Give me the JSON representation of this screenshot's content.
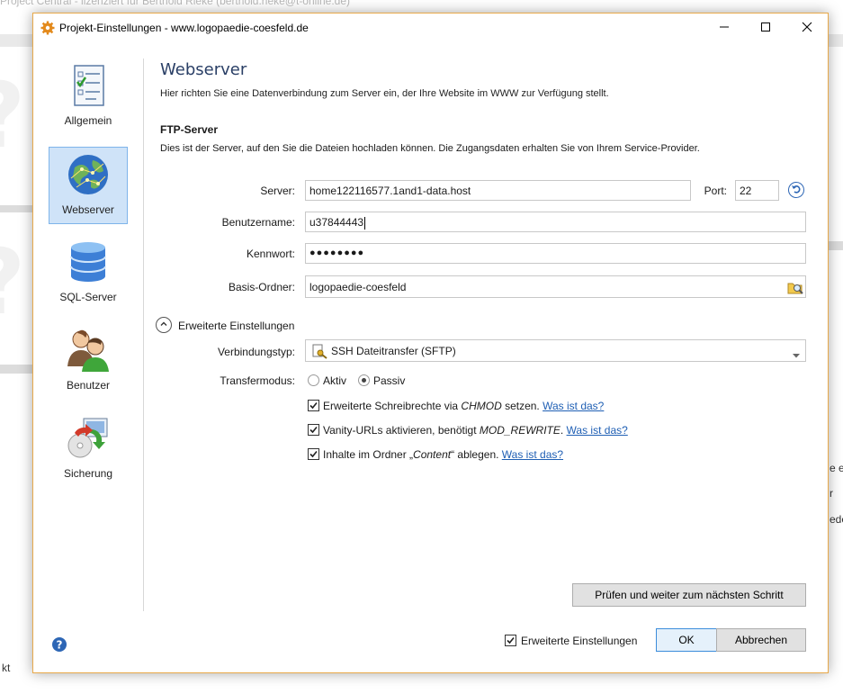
{
  "background": {
    "title": "Project Central - lizenziert für Berthold Rieke (berthold.rieke@t-online.de)",
    "right_snippets": [
      "e er",
      "r",
      "ede"
    ],
    "bottom_left_text": "kt"
  },
  "dialog": {
    "title": "Projekt-Einstellungen - www.logopaedie-coesfeld.de",
    "sidebar": {
      "items": [
        {
          "label": "Allgemein",
          "icon": "checklist-icon",
          "active": false
        },
        {
          "label": "Webserver",
          "icon": "globe-icon",
          "active": true
        },
        {
          "label": "SQL-Server",
          "icon": "database-icon",
          "active": false
        },
        {
          "label": "Benutzer",
          "icon": "users-icon",
          "active": false
        },
        {
          "label": "Sicherung",
          "icon": "backup-icon",
          "active": false
        }
      ]
    },
    "page": {
      "title": "Webserver",
      "description": "Hier richten Sie eine Datenverbindung zum Server ein, der Ihre Website im WWW zur Verfügung stellt.",
      "section_title": "FTP-Server",
      "section_description": "Dies ist der Server, auf den Sie die Dateien hochladen können. Die Zugangsdaten erhalten Sie von Ihrem Service-Provider."
    },
    "form": {
      "server_label": "Server:",
      "server_value": "home122116577.1and1-data.host",
      "port_label": "Port:",
      "port_value": "22",
      "username_label": "Benutzername:",
      "username_value": "u37844443",
      "password_label": "Kennwort:",
      "password_value": "●●●●●●●●",
      "base_folder_label": "Basis-Ordner:",
      "base_folder_value": "logopaedie-coesfeld"
    },
    "advanced": {
      "toggle_label": "Erweiterte Einstellungen",
      "connection_type_label": "Verbindungstyp:",
      "connection_type_value": "SSH Dateitransfer (SFTP)",
      "transfer_mode_label": "Transfermodus:",
      "transfer_modes": [
        {
          "label": "Aktiv",
          "selected": false
        },
        {
          "label": "Passiv",
          "selected": true
        }
      ],
      "options": [
        {
          "pre": "Erweiterte Schreibrechte via ",
          "em": "CHMOD",
          "post": " setzen.",
          "link": "Was ist das?",
          "checked": true
        },
        {
          "pre": "Vanity-URLs aktivieren, benötigt ",
          "em": "MOD_REWRITE",
          "post": ".",
          "link": "Was ist das?",
          "checked": true
        },
        {
          "pre": "Inhalte im Ordner „",
          "em": "Content",
          "post": "“ ablegen.",
          "link": "Was ist das?",
          "checked": true
        }
      ]
    },
    "check_button": "Prüfen und weiter zum nächsten Schritt",
    "footer": {
      "advanced_checkbox_label": "Erweiterte Einstellungen",
      "advanced_checked": true,
      "ok_label": "OK",
      "cancel_label": "Abbrechen"
    }
  }
}
